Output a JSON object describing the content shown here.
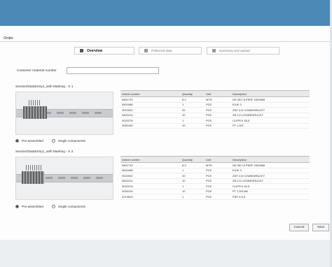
{
  "page": {
    "title": "Order"
  },
  "steps": [
    {
      "label": "Overview"
    },
    {
      "label": "Preferred data"
    },
    {
      "label": "Summary and upload"
    }
  ],
  "customer": {
    "label": "Customer material number",
    "value": ""
  },
  "sections": [
    {
      "title": "Section/DataEntry1_with Marking - X 1",
      "radio_preassembled": "Pre-assembled",
      "radio_single": "Single components",
      "columns": [
        "Article number",
        "Quantity",
        "Unit",
        "Description"
      ],
      "rows": [
        [
          "0801733",
          "8.2",
          "MTR",
          "NS 35/7,5 PERF 2000MM"
        ],
        [
          "0801988",
          "1",
          "PCE",
          "E/UK 3"
        ],
        [
          "3022052",
          "20",
          "PCE",
          "ZDF 2,5/ 4-N/BEDRUCKT"
        ],
        [
          "0802414",
          "10",
          "PCE",
          "ZB 2,5 LGS/BEDRUCKT"
        ],
        [
          "3022276",
          "1",
          "PCE",
          "CLIPFIX 35-5"
        ],
        [
          "3050160",
          "10",
          "PCE",
          "PT 1,5/S"
        ]
      ]
    },
    {
      "title": "Section/DataEntry1_with Marking - X 2",
      "radio_preassembled": "Pre-assembled",
      "radio_single": "Single components",
      "columns": [
        "Article number",
        "Quantity",
        "Unit",
        "Description"
      ],
      "rows": [
        [
          "0801733",
          "8.3",
          "MTR",
          "NS 35/7,5 PERF 2000MM"
        ],
        [
          "0801988",
          "1",
          "PCE",
          "E/UK 3"
        ],
        [
          "3022052",
          "20",
          "PCE",
          "ZDF 2,5/ 4-N/BEDRUCKT"
        ],
        [
          "0802414",
          "10",
          "PCE",
          "ZB 2,5 LGS/BEDRUCKT"
        ],
        [
          "3022276",
          "1",
          "PCE",
          "CLIPFIX 35-5"
        ],
        [
          "3050126",
          "10",
          "PCE",
          "PT 1,5/S-BK"
        ],
        [
          "3213543",
          "1",
          "PCE",
          "FBS 3-5,5"
        ]
      ]
    }
  ],
  "buttons": {
    "cancel": "Cancel",
    "next": "Next"
  }
}
